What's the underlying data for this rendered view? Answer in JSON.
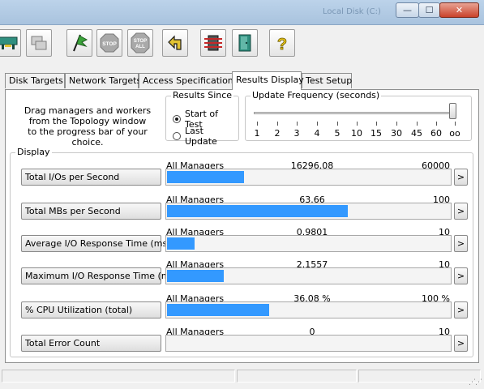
{
  "window": {
    "title": "Local Disk (C:)",
    "minimize_icon": "minimize-icon",
    "maximize_icon": "maximize-icon",
    "close_icon": "close-icon",
    "min_glyph": "—",
    "max_glyph": "☐",
    "close_glyph": "✕"
  },
  "toolbar": [
    {
      "name": "topology-icon",
      "color": "#2f8f7f"
    },
    {
      "name": "copy-worker-icon",
      "color": "#9a9a9a"
    },
    {
      "name": "start-flag-icon",
      "color": "#3aa33a"
    },
    {
      "name": "stop-icon",
      "label": "STOP",
      "color": "#9a9a9a"
    },
    {
      "name": "stop-all-icon",
      "label": "STOP ALL",
      "color": "#9a9a9a"
    },
    {
      "name": "reset-workers-icon",
      "color": "#e2c232"
    },
    {
      "name": "disconnect-icon",
      "color": "#c62828"
    },
    {
      "name": "exit-icon",
      "color": "#2f8f7f"
    },
    {
      "name": "help-icon",
      "label": "?",
      "color": "#e8c51a"
    }
  ],
  "tabs": [
    {
      "label": "Disk Targets",
      "active": false
    },
    {
      "label": "Network Targets",
      "active": false
    },
    {
      "label": "Access Specifications",
      "active": false
    },
    {
      "label": "Results Display",
      "active": true
    },
    {
      "label": "Test Setup",
      "active": false
    }
  ],
  "hint": {
    "line1": "Drag managers and workers",
    "line2": "from the Topology window",
    "line3": "to the progress bar of your choice."
  },
  "results_since": {
    "title": "Results Since",
    "options": [
      {
        "label": "Start of Test",
        "selected": true
      },
      {
        "label": "Last Update",
        "selected": false
      }
    ]
  },
  "update_frequency": {
    "title": "Update Frequency (seconds)",
    "ticks": [
      "1",
      "2",
      "3",
      "4",
      "5",
      "10",
      "15",
      "30",
      "45",
      "60",
      "oo"
    ],
    "selected": "oo"
  },
  "display": {
    "title": "Display",
    "bar_color": "#3399ff",
    "rows": [
      {
        "label": "Total I/Os per Second",
        "scope": "All Managers",
        "value": "16296.08",
        "max": "60000",
        "fraction": 0.27
      },
      {
        "label": "Total MBs per Second",
        "scope": "All Managers",
        "value": "63.66",
        "max": "100",
        "fraction": 0.6366
      },
      {
        "label": "Average I/O Response Time (ms)",
        "scope": "All Managers",
        "value": "0.9801",
        "max": "10",
        "fraction": 0.098
      },
      {
        "label": "Maximum I/O Response Time (ms)",
        "scope": "All Managers",
        "value": "2.1557",
        "max": "10",
        "fraction": 0.2
      },
      {
        "label": "% CPU Utilization (total)",
        "scope": "All Managers",
        "value": "36.08 %",
        "max": "100 %",
        "fraction": 0.36
      },
      {
        "label": "Total Error Count",
        "scope": "All Managers",
        "value": "0",
        "max": "10",
        "fraction": 0
      }
    ],
    "arrow_glyph": ">"
  }
}
